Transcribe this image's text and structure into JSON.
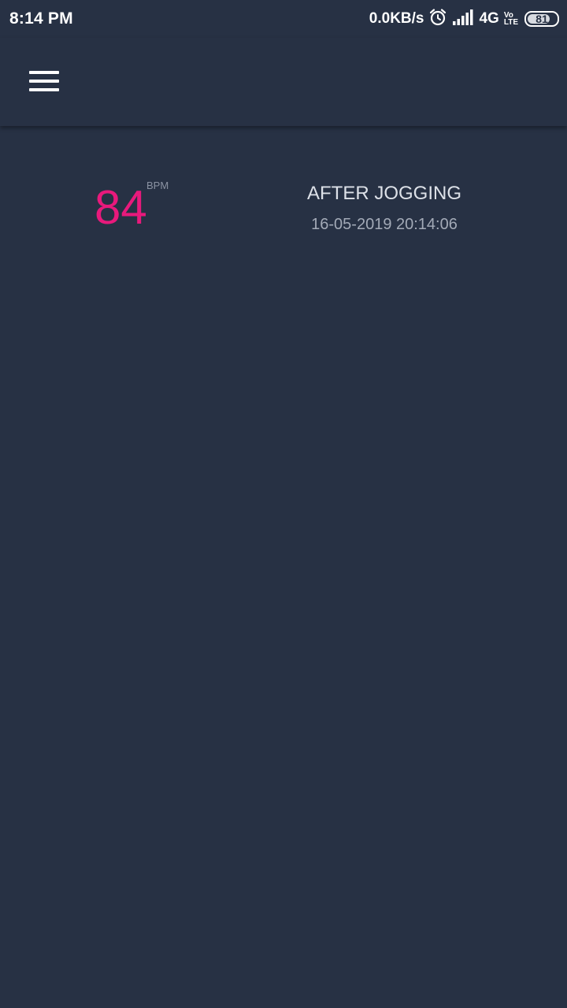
{
  "status_bar": {
    "time": "8:14 PM",
    "net_speed": "0.0KB/s",
    "network_type": "4G",
    "volte_top": "Vo",
    "volte_bottom": "LTE",
    "battery_level": "81",
    "icons": [
      "alarm-icon",
      "signal-icon"
    ]
  },
  "app_bar": {
    "menu_icon": "hamburger-menu-icon"
  },
  "reading": {
    "value": "84",
    "unit": "BPM",
    "label": "AFTER JOGGING",
    "timestamp": "16-05-2019 20:14:06"
  },
  "colors": {
    "background": "#273144",
    "accent": "#e8197c",
    "primary_text": "#dde1e8",
    "secondary_text": "#a3aab7"
  }
}
